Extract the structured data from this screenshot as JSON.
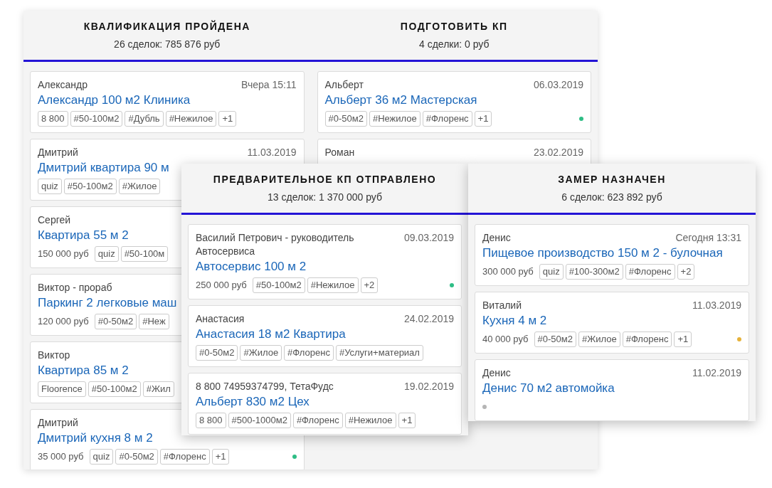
{
  "back_board": {
    "columns": [
      {
        "title": "КВАЛИФИКАЦИЯ ПРОЙДЕНА",
        "summary": "26 сделок: 785 876 руб",
        "cards": [
          {
            "contact": "Александр",
            "date": "Вчера 15:11",
            "title": "Александр 100 м2 Клиника",
            "tags": [
              "8 800",
              "#50-100м2",
              "#Дубль",
              "#Нежилое",
              "+1"
            ]
          },
          {
            "contact": "Дмитрий",
            "date": "11.03.2019",
            "title": "Дмитрий квартира 90 м",
            "tags": [
              "quiz",
              "#50-100м2",
              "#Жилое"
            ]
          },
          {
            "contact": "Сергей",
            "title": "Квартира 55 м 2",
            "price": "150 000 руб",
            "tags": [
              "quiz",
              "#50-100м"
            ]
          },
          {
            "contact": "Виктор - прораб",
            "title": "Паркинг 2 легковые маш",
            "price": "120 000 руб",
            "tags": [
              "#0-50м2",
              "#Неж"
            ]
          },
          {
            "contact": "Виктор",
            "title": "Квартира 85 м 2",
            "tags": [
              "Floorence",
              "#50-100м2",
              "#Жил"
            ]
          },
          {
            "contact": "Дмитрий",
            "title": "Дмитрий кухня 8 м 2",
            "price": "35 000 руб",
            "tags": [
              "quiz",
              "#0-50м2",
              "#Флоренс",
              "+1"
            ],
            "color": "#2ebd85"
          }
        ]
      },
      {
        "title": "ПОДГОТОВИТЬ КП",
        "summary": "4 сделки: 0 руб",
        "cards": [
          {
            "contact": "Альберт",
            "date": "06.03.2019",
            "title": "Альберт 36 м2 Мастерская",
            "tags": [
              "#0-50м2",
              "#Нежилое",
              "#Флоренс",
              "+1"
            ],
            "color": "#2ebd85"
          },
          {
            "contact": "Роман",
            "date": "23.02.2019"
          }
        ]
      }
    ]
  },
  "front_columns": [
    {
      "title": "ПРЕДВАРИТЕЛЬНОЕ КП ОТПРАВЛЕНО",
      "summary": "13 сделок: 1 370 000 руб",
      "cards": [
        {
          "contact": "Василий Петрович - руководитель Автосервиса",
          "date": "09.03.2019",
          "title": "Автосервис 100 м 2",
          "price": "250 000 руб",
          "tags": [
            "#50-100м2",
            "#Нежилое",
            "+2"
          ],
          "color": "#2ebd85"
        },
        {
          "contact": "Анастасия",
          "date": "24.02.2019",
          "title": "Анастасия 18 м2 Квартира",
          "tags": [
            "#0-50м2",
            "#Жилое",
            "#Флоренс",
            "#Услуги+материал"
          ]
        },
        {
          "contact": "8 800 74959374799, ТетаФудс",
          "date": "19.02.2019",
          "title": "Альберт 830 м2 Цех",
          "tags": [
            "8 800",
            "#500-1000м2",
            "#Флоренс",
            "#Нежилое",
            "+1"
          ]
        }
      ]
    },
    {
      "title": "ЗАМЕР НАЗНАЧЕН",
      "summary": "6 сделок: 623 892 руб",
      "cards": [
        {
          "contact": "Денис",
          "date": "Сегодня 13:31",
          "title": "Пищевое производство 150 м 2 - булочная",
          "price": "300 000 руб",
          "tags": [
            "quiz",
            "#100-300м2",
            "#Флоренс",
            "+2"
          ]
        },
        {
          "contact": "Виталий",
          "date": "11.03.2019",
          "title": "Кухня 4 м 2",
          "price": "40 000 руб",
          "tags": [
            "#0-50м2",
            "#Жилое",
            "#Флоренс",
            "+1"
          ],
          "color": "#e6b23a"
        },
        {
          "contact": "Денис",
          "date": "11.02.2019",
          "title": "Денис 70 м2 автомойка",
          "color": "#b5b5b5"
        }
      ]
    }
  ]
}
